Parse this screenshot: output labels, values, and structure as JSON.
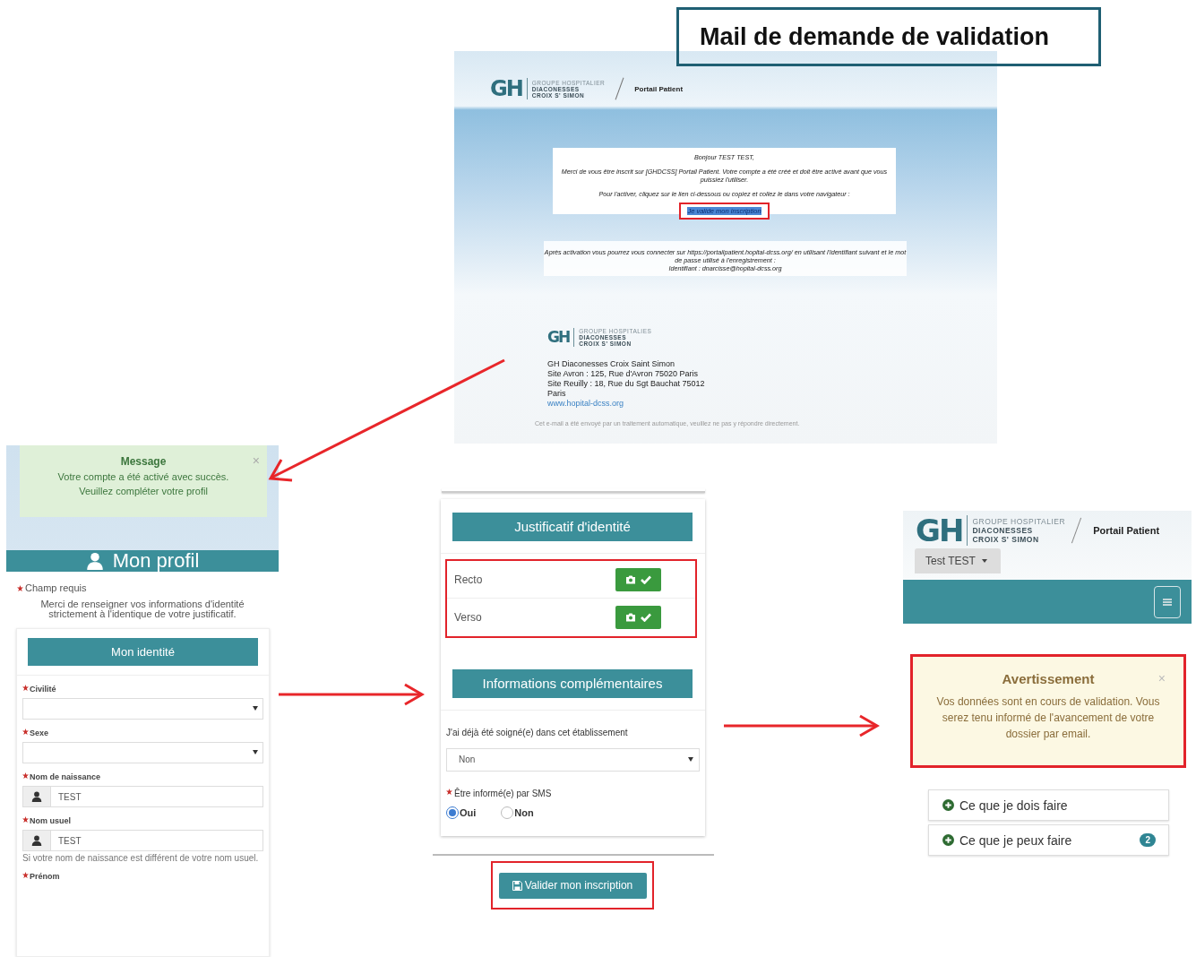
{
  "title": "Mail de demande de validation",
  "email": {
    "logo": {
      "mark": "GH",
      "lines": [
        "GROUPE HOSPITALIER",
        "DIACONESSES",
        "CROIX S' SIMON"
      ]
    },
    "portal": "Portail Patient",
    "greeting": "Bonjour TEST TEST,",
    "body": "Merci de vous être inscrit sur [GHDCSS] Portail Patient. Votre compte a été créé et doit être activé avant que vous puissiez l'utiliser.",
    "instruction": "Pour l'activer, cliquez sur le lien ci-dessous ou copiez et collez le dans votre navigateur :",
    "link": "Je valide mon inscription",
    "after": "Après activation vous pourrez vous connecter sur https://portailpatient.hopital-dcss.org/ en utilisant l'identifiant suivant et le mot de passe utilisé à l'enregistrement :",
    "identifier": "Identifiant : dnarcisse@hopital-dcss.org",
    "footer_logo": {
      "mark": "GH",
      "lines": [
        "GROUPE HOSPITALIES",
        "DIACONESSES",
        "CROIX S' SIMON"
      ]
    },
    "address": [
      "GH Diaconesses Croix Saint Simon",
      "Site Avron : 125, Rue d'Avron 75020 Paris",
      "Site Reuilly : 18, Rue du Sgt Bauchat 75012",
      "Paris"
    ],
    "website": "www.hopital-dcss.org",
    "disclaimer": "Cet e-mail a été envoyé par un traitement automatique, veuillez ne pas y répondre directement."
  },
  "profile": {
    "alert": {
      "title": "Message",
      "lines": [
        "Votre compte a été activé avec succès.",
        "Veuillez compléter votre profil"
      ],
      "close": "×"
    },
    "heading": "Mon profil",
    "required_note": "Champ requis",
    "intro": "Merci de renseigner vos informations d'identité strictement à l'identique de votre justificatif.",
    "section": "Mon identité",
    "fields": [
      {
        "kind": "select",
        "label": "Civilité",
        "required": true
      },
      {
        "kind": "select",
        "label": "Sexe",
        "required": true
      },
      {
        "kind": "text",
        "label": "Nom de naissance",
        "required": true,
        "value": "TEST"
      },
      {
        "kind": "text",
        "label": "Nom usuel",
        "required": true,
        "value": "TEST",
        "help": "Si votre nom de naissance est différent de votre nom usuel."
      },
      {
        "kind": "label",
        "label": "Prénom",
        "required": true
      }
    ]
  },
  "documents": {
    "section": "Justificatif d'identité",
    "items": [
      {
        "label": "Recto",
        "uploaded": true
      },
      {
        "label": "Verso",
        "uploaded": true
      }
    ],
    "info_section": "Informations complémentaires",
    "treated_label": "J'ai déjà été soigné(e) dans cet établissement",
    "treated_value": "Non",
    "sms_label": "Être informé(e) par SMS",
    "sms_required": true,
    "sms_options": [
      {
        "label": "Oui",
        "selected": true
      },
      {
        "label": "Non",
        "selected": false
      }
    ],
    "submit": "Valider mon inscription"
  },
  "dashboard": {
    "logo": {
      "mark": "GH",
      "lines": [
        "GROUPE HOSPITALIER",
        "DIACONESSES",
        "CROIX S' SIMON"
      ]
    },
    "portal": "Portail Patient",
    "user_menu": "Test TEST",
    "alert": {
      "title": "Avertissement",
      "text": "Vos données sont en cours de validation. Vous serez tenu informé de l'avancement de votre dossier par email.",
      "close": "×"
    },
    "items": [
      {
        "label": "Ce que je dois faire"
      },
      {
        "label": "Ce que je peux faire",
        "badge": "2"
      }
    ]
  }
}
